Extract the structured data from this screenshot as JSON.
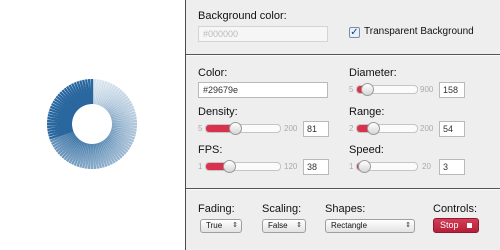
{
  "preview": {
    "color": "#29679e",
    "track_color": "#c7d8e6",
    "icon": "donut-spinner-icon"
  },
  "background": {
    "label": "Background color:",
    "value": "#000000",
    "transparent_label": "Transparent Background",
    "transparent_checked": true
  },
  "color": {
    "label": "Color:",
    "value": "#29679e"
  },
  "diameter": {
    "label": "Diameter:",
    "min": "5",
    "max": "900",
    "value": "158",
    "level": 0.17
  },
  "density": {
    "label": "Density:",
    "min": "5",
    "max": "200",
    "value": "81",
    "level": 0.39
  },
  "range": {
    "label": "Range:",
    "min": "2",
    "max": "200",
    "value": "54",
    "level": 0.26
  },
  "fps": {
    "label": "FPS:",
    "min": "1",
    "max": "120",
    "value": "38",
    "level": 0.31
  },
  "speed": {
    "label": "Speed:",
    "min": "1",
    "max": "20",
    "value": "3",
    "level": 0.11
  },
  "fading": {
    "label": "Fading:",
    "value": "True"
  },
  "scaling": {
    "label": "Scaling:",
    "value": "False"
  },
  "shapes": {
    "label": "Shapes:",
    "value": "Rectangle"
  },
  "controls": {
    "label": "Controls:",
    "button": "Stop",
    "icon": "stop-square-icon"
  },
  "accent": "#d8324e"
}
